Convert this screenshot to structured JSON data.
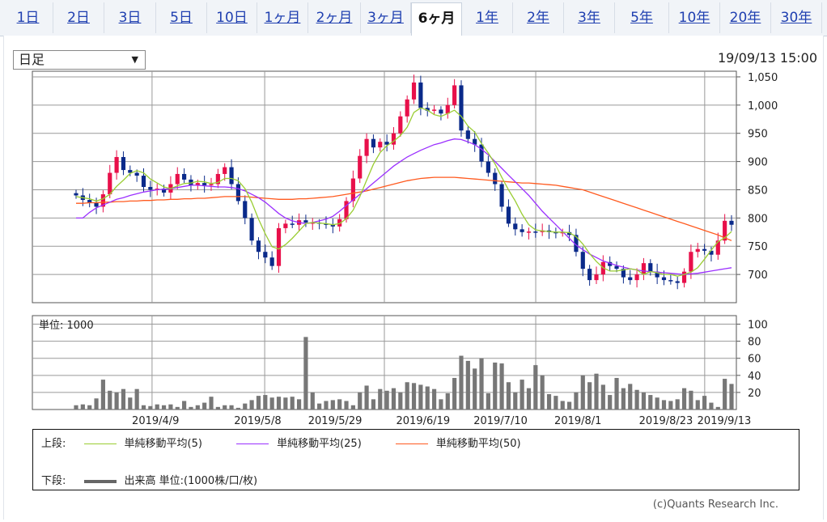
{
  "tabs": [
    {
      "label": "1日"
    },
    {
      "label": "2日"
    },
    {
      "label": "3日"
    },
    {
      "label": "5日"
    },
    {
      "label": "10日"
    },
    {
      "label": "1ヶ月"
    },
    {
      "label": "2ヶ月"
    },
    {
      "label": "3ヶ月"
    },
    {
      "label": "6ヶ月",
      "active": true
    },
    {
      "label": "1年"
    },
    {
      "label": "2年"
    },
    {
      "label": "3年"
    },
    {
      "label": "5年"
    },
    {
      "label": "10年"
    },
    {
      "label": "20年"
    },
    {
      "label": "30年"
    }
  ],
  "period_select": {
    "value": "日足",
    "arrow": "▼"
  },
  "timestamp": "19/09/13 15:00",
  "volume_unit_label": "単位: 1000",
  "legend": {
    "upper_label": "上段:",
    "lower_label": "下段:",
    "items": [
      {
        "label": "単純移動平均(5)",
        "color": "#9acd32"
      },
      {
        "label": "単純移動平均(25)",
        "color": "#9b30ff"
      },
      {
        "label": "単純移動平均(50)",
        "color": "#ff5a1f"
      }
    ],
    "volume_label": "出来高 単位:(1000株/口/枚)",
    "volume_color": "#666666"
  },
  "copyright": "(c)Quants Research Inc.",
  "colors": {
    "up": "#e8104a",
    "down": "#0a2a8a",
    "grid": "#999999",
    "volume": "#777777"
  },
  "chart_data": [
    {
      "type": "candlestick",
      "ylim": [
        650,
        1060
      ],
      "yticks": [
        "700",
        "750",
        "800",
        "850",
        "900",
        "950",
        "1,000",
        "1,050"
      ],
      "x_tick_labels": [
        "2019/4/9",
        "2019/5/8",
        "2019/5/29",
        "2019/6/19",
        "2019/7/10",
        "2019/8/1",
        "2019/8/23",
        "2019/9/13"
      ],
      "grid": true,
      "close": [
        840,
        832,
        827,
        820,
        842,
        880,
        908,
        885,
        880,
        875,
        855,
        850,
        852,
        845,
        860,
        878,
        868,
        858,
        862,
        858,
        860,
        878,
        890,
        860,
        830,
        800,
        760,
        740,
        730,
        715,
        782,
        790,
        788,
        796,
        792,
        792,
        790,
        788,
        785,
        798,
        830,
        870,
        910,
        940,
        925,
        935,
        930,
        950,
        980,
        1010,
        1040,
        995,
        990,
        992,
        985,
        1000,
        1035,
        955,
        940,
        930,
        900,
        880,
        860,
        820,
        790,
        780,
        775,
        776,
        775,
        778,
        775,
        773,
        775,
        770,
        740,
        710,
        690,
        700,
        722,
        715,
        710,
        695,
        690,
        700,
        720,
        705,
        695,
        690,
        688,
        685,
        705,
        740,
        745,
        742,
        735,
        760,
        795,
        788
      ],
      "ma5": [
        838,
        836,
        834,
        830,
        834,
        842,
        856,
        867,
        879,
        884,
        880,
        869,
        862,
        855,
        852,
        857,
        861,
        862,
        865,
        864,
        861,
        863,
        870,
        870,
        866,
        852,
        828,
        798,
        772,
        749,
        745,
        753,
        764,
        777,
        790,
        792,
        791,
        790,
        788,
        790,
        799,
        814,
        838,
        867,
        895,
        916,
        928,
        936,
        946,
        961,
        987,
        995,
        991,
        983,
        980,
        985,
        991,
        980,
        963,
        952,
        932,
        915,
        896,
        872,
        850,
        830,
        807,
        788,
        779,
        777,
        776,
        775,
        775,
        774,
        767,
        754,
        737,
        723,
        712,
        706,
        706,
        708,
        710,
        708,
        700,
        705,
        703,
        700,
        700,
        697,
        700,
        704,
        712,
        727,
        743,
        758,
        765,
        776
      ],
      "ma25": [
        800,
        800,
        810,
        818,
        823,
        828,
        833,
        836,
        840,
        843,
        846,
        848,
        850,
        851,
        852,
        854,
        856,
        858,
        858,
        857,
        856,
        855,
        855,
        854,
        852,
        848,
        842,
        836,
        828,
        818,
        808,
        800,
        795,
        792,
        790,
        792,
        795,
        798,
        803,
        812,
        822,
        832,
        842,
        852,
        862,
        872,
        882,
        892,
        900,
        908,
        914,
        920,
        925,
        930,
        933,
        937,
        940,
        939,
        935,
        930,
        922,
        912,
        900,
        888,
        876,
        864,
        852,
        840,
        826,
        812,
        800,
        788,
        776,
        764,
        752,
        744,
        736,
        730,
        724,
        720,
        716,
        713,
        710,
        708,
        706,
        705,
        704,
        703,
        702,
        701,
        700,
        701,
        702,
        704,
        706,
        708,
        710,
        712
      ],
      "ma50": [
        826,
        826,
        827,
        827,
        828,
        828,
        829,
        829,
        830,
        830,
        831,
        831,
        832,
        832,
        833,
        833,
        834,
        834,
        835,
        835,
        836,
        837,
        838,
        838,
        838,
        838,
        837,
        836,
        835,
        834,
        833,
        833,
        833,
        834,
        834,
        835,
        836,
        837,
        838,
        840,
        842,
        844,
        846,
        848,
        851,
        854,
        857,
        860,
        863,
        866,
        868,
        870,
        871,
        872,
        872,
        872,
        872,
        871,
        870,
        869,
        868,
        867,
        866,
        865,
        864,
        863,
        862,
        862,
        861,
        860,
        859,
        858,
        856,
        854,
        852,
        850,
        846,
        842,
        838,
        834,
        830,
        826,
        822,
        818,
        814,
        810,
        806,
        802,
        798,
        794,
        790,
        786,
        782,
        778,
        774,
        770,
        765,
        760
      ],
      "volume": [
        5,
        6,
        5,
        13,
        35,
        22,
        20,
        24,
        14,
        24,
        5,
        4,
        6,
        5,
        6,
        3,
        10,
        3,
        5,
        8,
        15,
        3,
        5,
        5,
        2,
        7,
        11,
        16,
        17,
        14,
        15,
        14,
        15,
        12,
        85,
        20,
        7,
        10,
        11,
        12,
        10,
        5,
        20,
        28,
        12,
        24,
        22,
        25,
        20,
        32,
        31,
        29,
        27,
        24,
        12,
        19,
        37,
        63,
        57,
        48,
        60,
        19,
        55,
        54,
        32,
        20,
        35,
        25,
        52,
        40,
        18,
        16,
        10,
        9,
        20,
        40,
        32,
        42,
        29,
        17,
        37,
        25,
        30,
        23,
        20,
        17,
        14,
        11,
        10,
        12,
        25,
        22,
        11,
        16,
        8,
        3,
        36,
        30
      ]
    },
    {
      "type": "bar",
      "title": "単位: 1000",
      "ylim": [
        0,
        110
      ],
      "yticks": [
        "20",
        "40",
        "60",
        "80",
        "100"
      ]
    }
  ]
}
